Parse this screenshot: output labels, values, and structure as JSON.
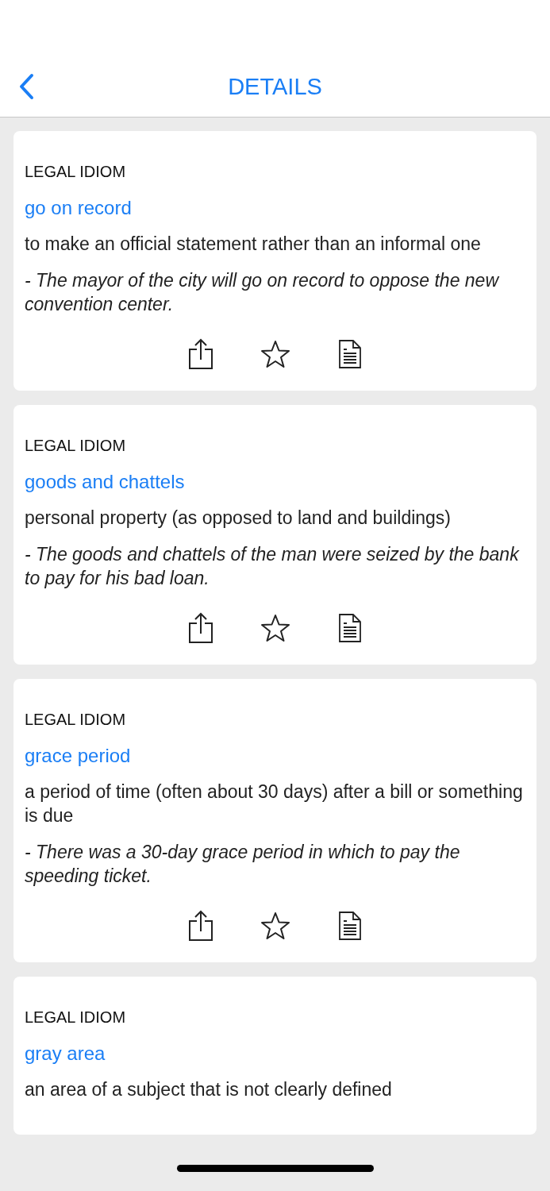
{
  "nav": {
    "title": "DETAILS"
  },
  "entries": [
    {
      "category": "LEGAL IDIOM",
      "term": "go on record",
      "definition": "to make an official statement rather than an informal one",
      "example": "- The mayor of the city will go on record to oppose the new convention center.",
      "favorited": false
    },
    {
      "category": "LEGAL IDIOM",
      "term": "goods and chattels",
      "definition": "personal property (as opposed to land and buildings)",
      "example": "- The goods and chattels of the man were seized by the bank to pay for his bad loan.",
      "favorited": false
    },
    {
      "category": "LEGAL IDIOM",
      "term": "grace period",
      "definition": "a period of time (often about 30 days) after a bill or something is due",
      "example": "- There was a 30-day grace period in which to pay the speeding ticket.",
      "favorited": false
    },
    {
      "category": "LEGAL IDIOM",
      "term": "gray area",
      "definition": "an area of a subject that is not clearly defined"
    }
  ]
}
